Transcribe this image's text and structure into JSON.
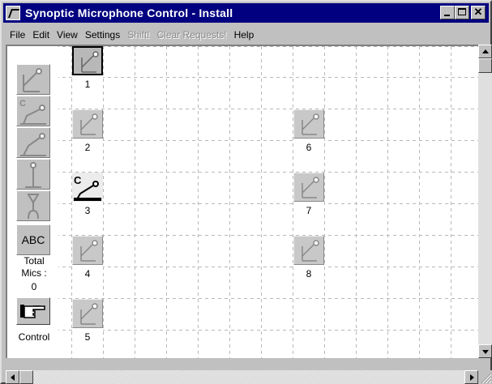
{
  "window": {
    "title": "Synoptic Microphone Control - Install"
  },
  "menu": [
    {
      "label": "File",
      "enabled": true
    },
    {
      "label": "Edit",
      "enabled": true
    },
    {
      "label": "View",
      "enabled": true
    },
    {
      "label": "Settings",
      "enabled": true
    },
    {
      "label": "Shift!",
      "enabled": false
    },
    {
      "label": "Clear Requests!",
      "enabled": false
    },
    {
      "label": "Help",
      "enabled": true
    }
  ],
  "palette": {
    "tools": [
      {
        "icon": "delegate-mic-icon"
      },
      {
        "icon": "chairman-mic-icon"
      },
      {
        "icon": "interpreter-mic-icon"
      },
      {
        "icon": "stand-mic-icon"
      },
      {
        "icon": "handheld-mic-icon"
      }
    ],
    "abc_label": "ABC",
    "total_mics_label_line1": "Total",
    "total_mics_label_line2": "Mics :",
    "total_mics_value": "0",
    "control_icon": "pointing-hand-icon",
    "control_label": "Control"
  },
  "mics": [
    {
      "label": "1",
      "type": "delegate",
      "selected": true
    },
    {
      "label": "2",
      "type": "delegate",
      "selected": false
    },
    {
      "label": "3",
      "type": "chairman",
      "selected": false
    },
    {
      "label": "4",
      "type": "delegate",
      "selected": false
    },
    {
      "label": "5",
      "type": "delegate",
      "selected": false
    },
    {
      "label": "6",
      "type": "delegate",
      "selected": false
    },
    {
      "label": "7",
      "type": "delegate",
      "selected": false
    },
    {
      "label": "8",
      "type": "delegate",
      "selected": false
    }
  ],
  "colors": {
    "titlebar": "#000080",
    "face": "#c0c0c0",
    "canvas": "#ffffff",
    "grid": "#b0b0b0"
  }
}
